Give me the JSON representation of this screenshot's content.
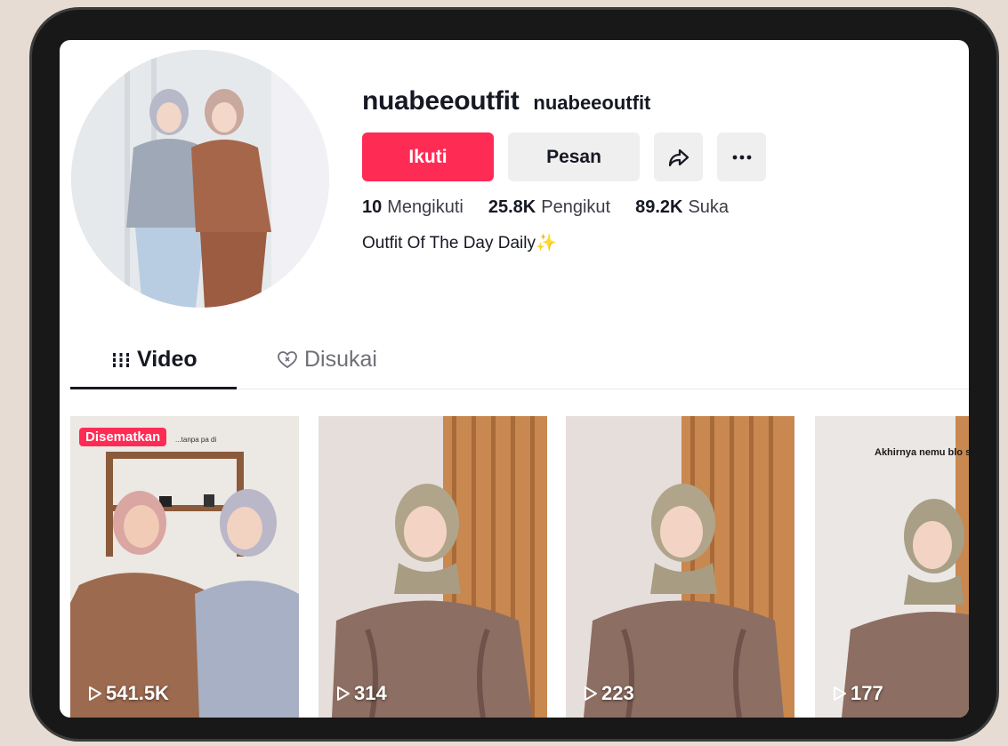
{
  "profile": {
    "display_name": "nuabeeoutfit",
    "handle": "nuabeeoutfit",
    "bio": "Outfit Of The Day Daily",
    "bio_emoji": "✨"
  },
  "actions": {
    "follow_label": "Ikuti",
    "message_label": "Pesan",
    "share_icon": "share-icon",
    "more_icon": "more-icon"
  },
  "stats": {
    "following_count": "10",
    "following_label": "Mengikuti",
    "followers_count": "25.8K",
    "followers_label": "Pengikut",
    "likes_count": "89.2K",
    "likes_label": "Suka"
  },
  "tabs": [
    {
      "label": "Video",
      "icon": "grid-icon",
      "active": true
    },
    {
      "label": "Disukai",
      "icon": "liked-heart-icon",
      "active": false
    }
  ],
  "videos": [
    {
      "views": "541.5K",
      "pinned_label": "Disematkan",
      "caption": "...tanpa pa di"
    },
    {
      "views": "314"
    },
    {
      "views": "223"
    },
    {
      "views": "177",
      "caption": "Akhirnya nemu blo secantik ini"
    }
  ],
  "colors": {
    "accent": "#fe2c55",
    "text": "#161823",
    "secondary_button": "#efefef"
  }
}
